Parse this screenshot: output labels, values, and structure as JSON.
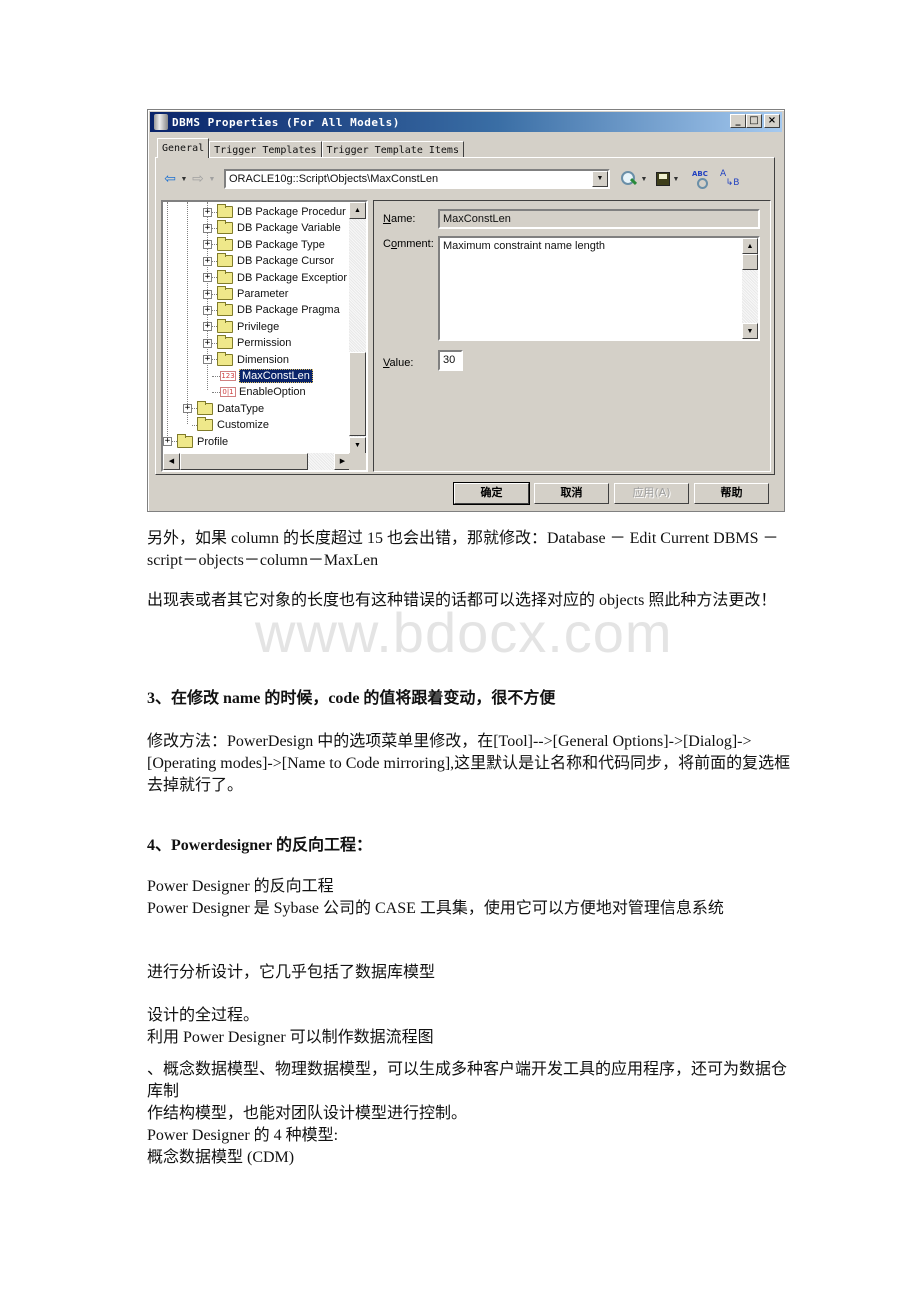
{
  "dialog": {
    "title": "DBMS Properties (For All Models)",
    "window_buttons": {
      "minimize": "_",
      "maximize": "□",
      "close": "×"
    },
    "tabs": [
      {
        "label": "General",
        "active": true
      },
      {
        "label": "Trigger Templates",
        "active": false
      },
      {
        "label": "Trigger Template Items",
        "active": false
      }
    ],
    "toolbar": {
      "back_icon": "arrow-left-icon",
      "forward_icon": "arrow-right-icon",
      "path_value": "ORACLE10g::Script\\Objects\\MaxConstLen",
      "find_icon": "find-icon",
      "save_icon": "save-icon",
      "spellcheck_icon": "spellcheck-icon",
      "replace_icon": "replace-icon"
    },
    "tree": {
      "items": [
        {
          "label": "DB Package Procedur",
          "type": "folder",
          "expandable": true
        },
        {
          "label": "DB Package Variable",
          "type": "folder",
          "expandable": true
        },
        {
          "label": "DB Package Type",
          "type": "folder",
          "expandable": true
        },
        {
          "label": "DB Package Cursor",
          "type": "folder",
          "expandable": true
        },
        {
          "label": "DB Package Exceptior",
          "type": "folder",
          "expandable": true
        },
        {
          "label": "Parameter",
          "type": "folder",
          "expandable": true
        },
        {
          "label": "DB Package Pragma",
          "type": "folder",
          "expandable": true
        },
        {
          "label": "Privilege",
          "type": "folder",
          "expandable": true
        },
        {
          "label": "Permission",
          "type": "folder",
          "expandable": true
        },
        {
          "label": "Dimension",
          "type": "folder",
          "expandable": true
        },
        {
          "label": "MaxConstLen",
          "type": "value",
          "badge": "123",
          "selected": true
        },
        {
          "label": "EnableOption",
          "type": "value",
          "badge": "0|1"
        },
        {
          "label": "DataType",
          "type": "folder",
          "expandable": true
        },
        {
          "label": "Customize",
          "type": "folder",
          "expandable": false
        },
        {
          "label": "Profile",
          "type": "folder",
          "expandable": true
        }
      ]
    },
    "form": {
      "name_label": "Name:",
      "name_value": "MaxConstLen",
      "comment_label": "Comment:",
      "comment_value": "Maximum constraint name length",
      "value_label": "Value:",
      "value_value": "30"
    },
    "buttons": {
      "ok": "确定",
      "cancel": "取消",
      "apply": "应用(A)",
      "help": "帮助"
    }
  },
  "document": {
    "paragraphs": [
      {
        "text": "另外，如果 column 的长度超过 15 也会出错，那就修改：Database － Edit Current DBMS －script－objects－column－MaxLen"
      },
      {
        "text": "出现表或者其它对象的长度也有这种错误的话都可以选择对应的 objects 照此种方法更改！"
      },
      {
        "text": "3、在修改 name 的时候，code 的值将跟着变动，很不方便",
        "heading": true
      },
      {
        "text": "修改方法：PowerDesign 中的选项菜单里修改，在[Tool]-->[General Options]->[Dialog]->[Operating modes]->[Name to Code mirroring],这里默认是让名称和代码同步，将前面的复选框去掉就行了。"
      },
      {
        "text": "4、Powerdesigner 的反向工程：",
        "heading": true
      },
      {
        "text": "Power Designer 的反向工程"
      },
      {
        "text": " Power Designer 是 Sybase 公司的 CASE 工具集，使用它可以方便地对管理信息系统"
      },
      {
        "text": "进行分析设计，它几乎包括了数据库模型"
      },
      {
        "text": "设计的全过程。"
      },
      {
        "text": "利用 Power Designer 可以制作数据流程图"
      },
      {
        "text": "、概念数据模型、物理数据模型，可以生成多种客户端开发工具的应用程序，还可为数据仓库制"
      },
      {
        "text": "作结构模型，也能对团队设计模型进行控制。"
      },
      {
        "text": "Power Designer 的 4 种模型:"
      },
      {
        "text": "概念数据模型 (CDM)"
      }
    ],
    "watermark": "www.bdocx.com"
  }
}
